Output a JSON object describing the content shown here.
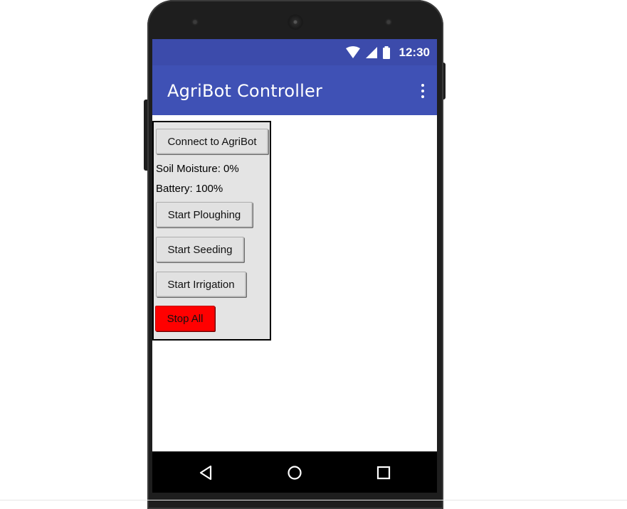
{
  "status_bar": {
    "time": "12:30",
    "icons": [
      "wifi-icon",
      "signal-icon",
      "battery-icon"
    ]
  },
  "app_bar": {
    "title": "AgriBot Controller",
    "menu_icon": "more-vert-icon"
  },
  "controls": {
    "connect_label": "Connect to AgriBot",
    "soil_moisture": "Soil Moisture: 0%",
    "battery": "Battery: 100%",
    "plough_label": "Start Ploughing",
    "seed_label": "Start Seeding",
    "irrigation_label": "Start Irrigation",
    "stop_label": "Stop All"
  },
  "nav_bar": {
    "icons": [
      "back-icon",
      "home-icon",
      "recents-icon"
    ]
  },
  "colors": {
    "status_bar": "#3c4bab",
    "app_bar": "#3f51b5",
    "stop_button": "#ff0000",
    "panel_background": "#e4e4e4"
  }
}
